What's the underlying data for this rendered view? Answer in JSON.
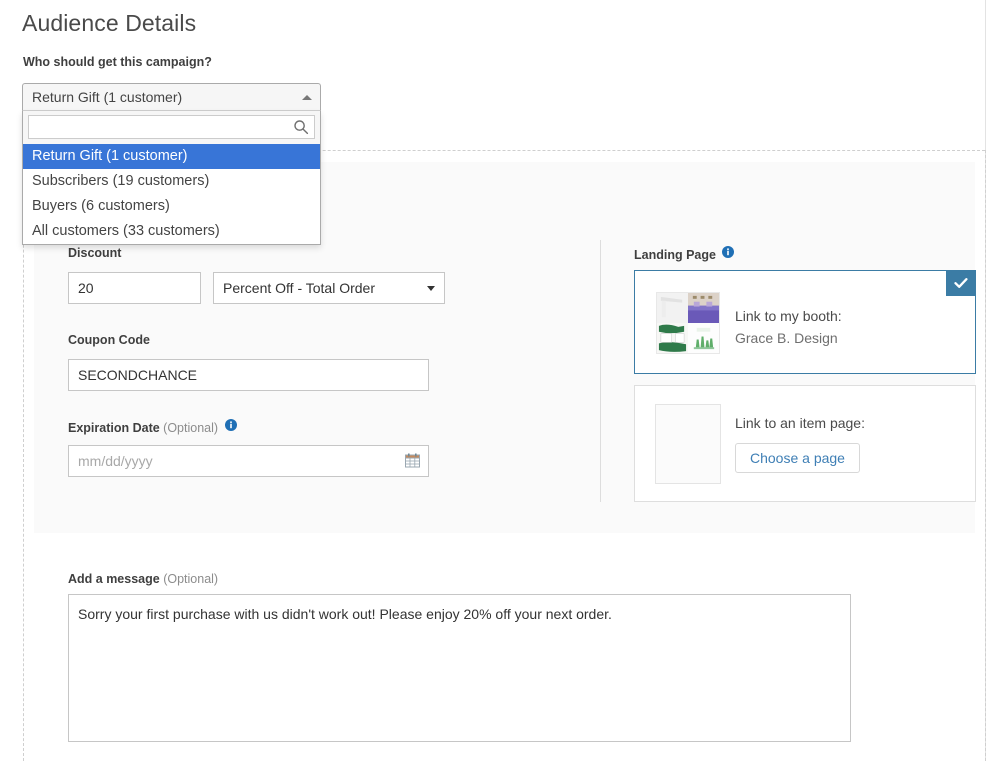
{
  "page": {
    "title": "Audience Details"
  },
  "audience": {
    "question": "Who should get this campaign?",
    "selected": "Return Gift (1 customer)",
    "search_placeholder": "",
    "search_value": "",
    "options": [
      "Return Gift (1 customer)",
      "Subscribers (19 customers)",
      "Buyers (6 customers)",
      "All customers (33 customers)"
    ],
    "caret_icon": "chevron-up-icon",
    "search_icon": "search-icon"
  },
  "discount": {
    "label": "Discount",
    "amount": "20",
    "type_value": "Percent Off - Total Order",
    "type_caret_icon": "chevron-down-icon"
  },
  "coupon": {
    "label": "Coupon Code",
    "value": "SECONDCHANCE"
  },
  "expiration": {
    "label": "Expiration Date",
    "optional": "(Optional)",
    "placeholder": "mm/dd/yyyy",
    "value": "",
    "info_icon": "info-icon",
    "calendar_icon": "calendar-icon"
  },
  "landing_page": {
    "label": "Landing Page",
    "info_icon": "info-icon",
    "booth": {
      "title": "Link to my booth:",
      "name": "Grace B. Design",
      "selected_icon": "check-icon",
      "thumbnail_colors": [
        "#efefef",
        "#6a59b8",
        "#3d7a4a",
        "#eaf3ea"
      ]
    },
    "item_page": {
      "title": "Link to an item page:",
      "button_label": "Choose a page"
    }
  },
  "message": {
    "label": "Add a message",
    "optional": "(Optional)",
    "value": "Sorry your first purchase with us didn't work out! Please enjoy 20% off your next order.",
    "placeholder": ""
  },
  "colors": {
    "highlight_blue": "#3875d7",
    "accent_steel": "#3b7ca5",
    "link_blue": "#3f7fb5",
    "panel_gray": "#fafafa"
  }
}
